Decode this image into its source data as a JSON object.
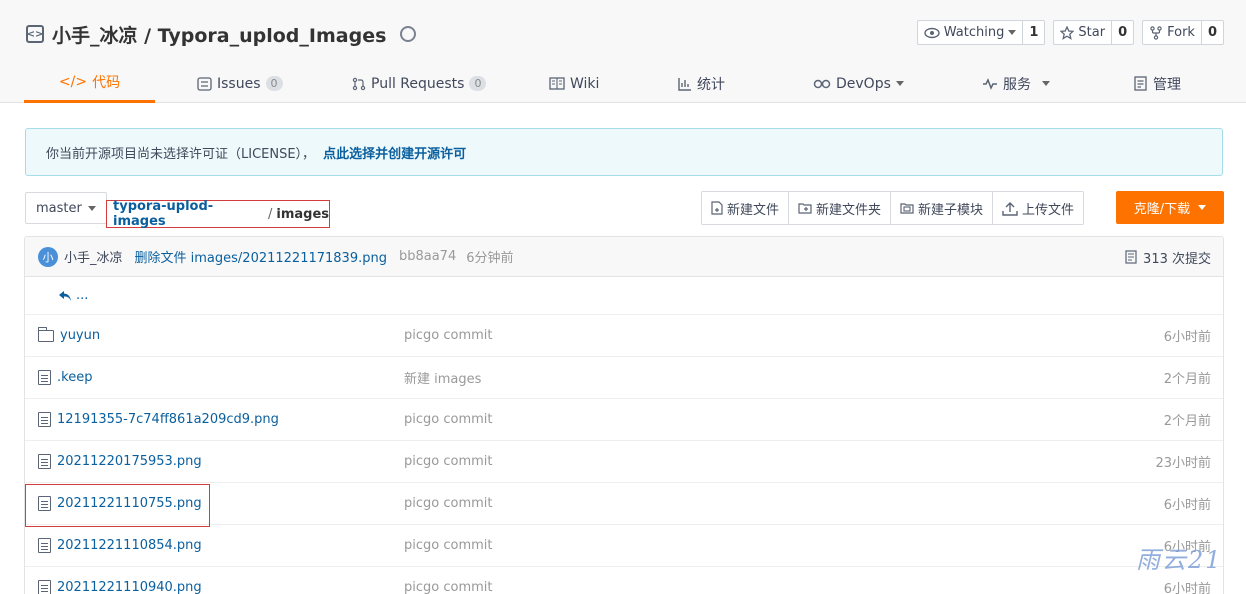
{
  "repo": {
    "title": "小手_冰凉 / Typora_uplod_Images"
  },
  "header_buttons": [
    {
      "label": "Watching",
      "count": "1",
      "icon": "eye-icon"
    },
    {
      "label": "Star",
      "count": "0",
      "icon": "star-icon"
    },
    {
      "label": "Fork",
      "count": "0",
      "icon": "fork-icon"
    }
  ],
  "tabs": [
    {
      "label": "代码",
      "icon": "code-icon",
      "active": true
    },
    {
      "label": "Issues",
      "count": "0",
      "icon": "issues-icon"
    },
    {
      "label": "Pull Requests",
      "count": "0",
      "icon": "pull-request-icon"
    },
    {
      "label": "Wiki",
      "icon": "wiki-icon"
    },
    {
      "label": "统计",
      "icon": "stats-icon"
    },
    {
      "label": "DevOps",
      "icon": "devops-icon"
    },
    {
      "label": "服务",
      "icon": "service-icon"
    },
    {
      "label": "管理",
      "icon": "manage-icon"
    }
  ],
  "license": {
    "text": "你当前开源项目尚未选择许可证（LICENSE），",
    "link": "点此选择并创建开源许可"
  },
  "branch": {
    "name": "master"
  },
  "breadcrumb": {
    "repo": "typora-uplod-images",
    "sep": "/",
    "dir": "images"
  },
  "actions": [
    {
      "label": "新建文件",
      "icon": "new-file-icon"
    },
    {
      "label": "新建文件夹",
      "icon": "new-folder-icon"
    },
    {
      "label": "新建子模块",
      "icon": "submodule-icon"
    },
    {
      "label": "上传文件",
      "icon": "upload-icon"
    }
  ],
  "clone_button": {
    "label": "克隆/下载"
  },
  "commit": {
    "avatar": "小",
    "author": "小手_冰凉",
    "message": "删除文件 images/20211221171839.png",
    "sha": "bb8aa74",
    "time": "6分钟前",
    "count_label": "313 次提交"
  },
  "up_link": "...",
  "files": [
    {
      "name": "yuyun",
      "type": "folder",
      "message": "picgo commit",
      "time": "6小时前"
    },
    {
      "name": ".keep",
      "type": "file",
      "message": "新建 images",
      "time": "2个月前"
    },
    {
      "name": "12191355-7c74ff861a209cd9.png",
      "type": "file",
      "message": "picgo commit",
      "time": "2个月前"
    },
    {
      "name": "20211220175953.png",
      "type": "file",
      "message": "picgo commit",
      "time": "23小时前"
    },
    {
      "name": "20211221110755.png",
      "type": "file",
      "message": "picgo commit",
      "time": "6小时前"
    },
    {
      "name": "20211221110854.png",
      "type": "file",
      "message": "picgo commit",
      "time": "6小时前"
    },
    {
      "name": "20211221110940.png",
      "type": "file",
      "message": "picgo commit",
      "time": "6小时前"
    }
  ],
  "watermark": "雨云21",
  "colors": {
    "accent": "#fe7300",
    "link": "#0a5f9e",
    "highlight_box": "#d53c3c"
  }
}
